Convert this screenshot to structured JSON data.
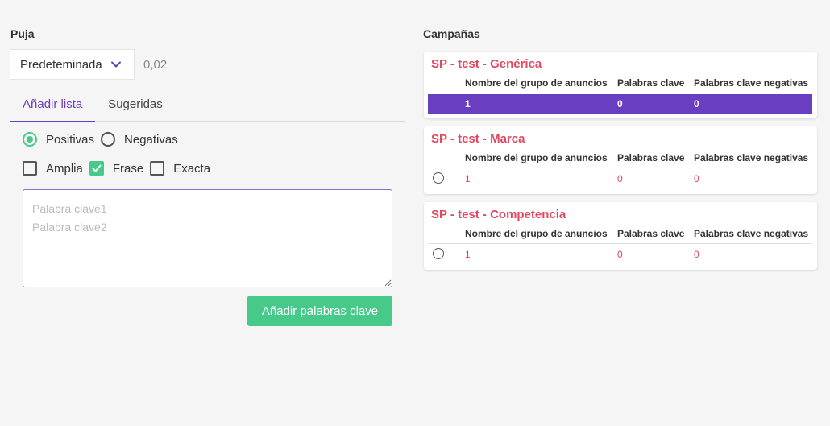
{
  "bid": {
    "title": "Puja",
    "strategy": "Predeteminada",
    "value": "0,02"
  },
  "tabs": [
    {
      "label": "Añadir lista",
      "active": true
    },
    {
      "label": "Sugeridas",
      "active": false
    }
  ],
  "polarity": {
    "positive_label": "Positivas",
    "negative_label": "Negativas",
    "selected": "positive"
  },
  "match_types": [
    {
      "label": "Amplia",
      "checked": false
    },
    {
      "label": "Frase",
      "checked": true
    },
    {
      "label": "Exacta",
      "checked": false
    }
  ],
  "keywords_input": {
    "value": "",
    "placeholder": "Palabra clave1\nPalabra clave2"
  },
  "add_button_label": "Añadir palabras clave",
  "campaigns": {
    "title": "Campañas",
    "columns": [
      "Nombre del grupo de anuncios",
      "Palabras clave",
      "Palabras clave negativas"
    ],
    "items": [
      {
        "name": "SP - test - Genérica",
        "row": [
          "1",
          "0",
          "0"
        ],
        "selected": true
      },
      {
        "name": "SP - test - Marca",
        "row": [
          "1",
          "0",
          "0"
        ],
        "selected": false
      },
      {
        "name": "SP - test - Competencia",
        "row": [
          "1",
          "0",
          "0"
        ],
        "selected": false
      }
    ]
  },
  "colors": {
    "accent_purple": "#6a3ec0",
    "accent_green": "#47c98a",
    "campaign_red": "#e2475f"
  }
}
